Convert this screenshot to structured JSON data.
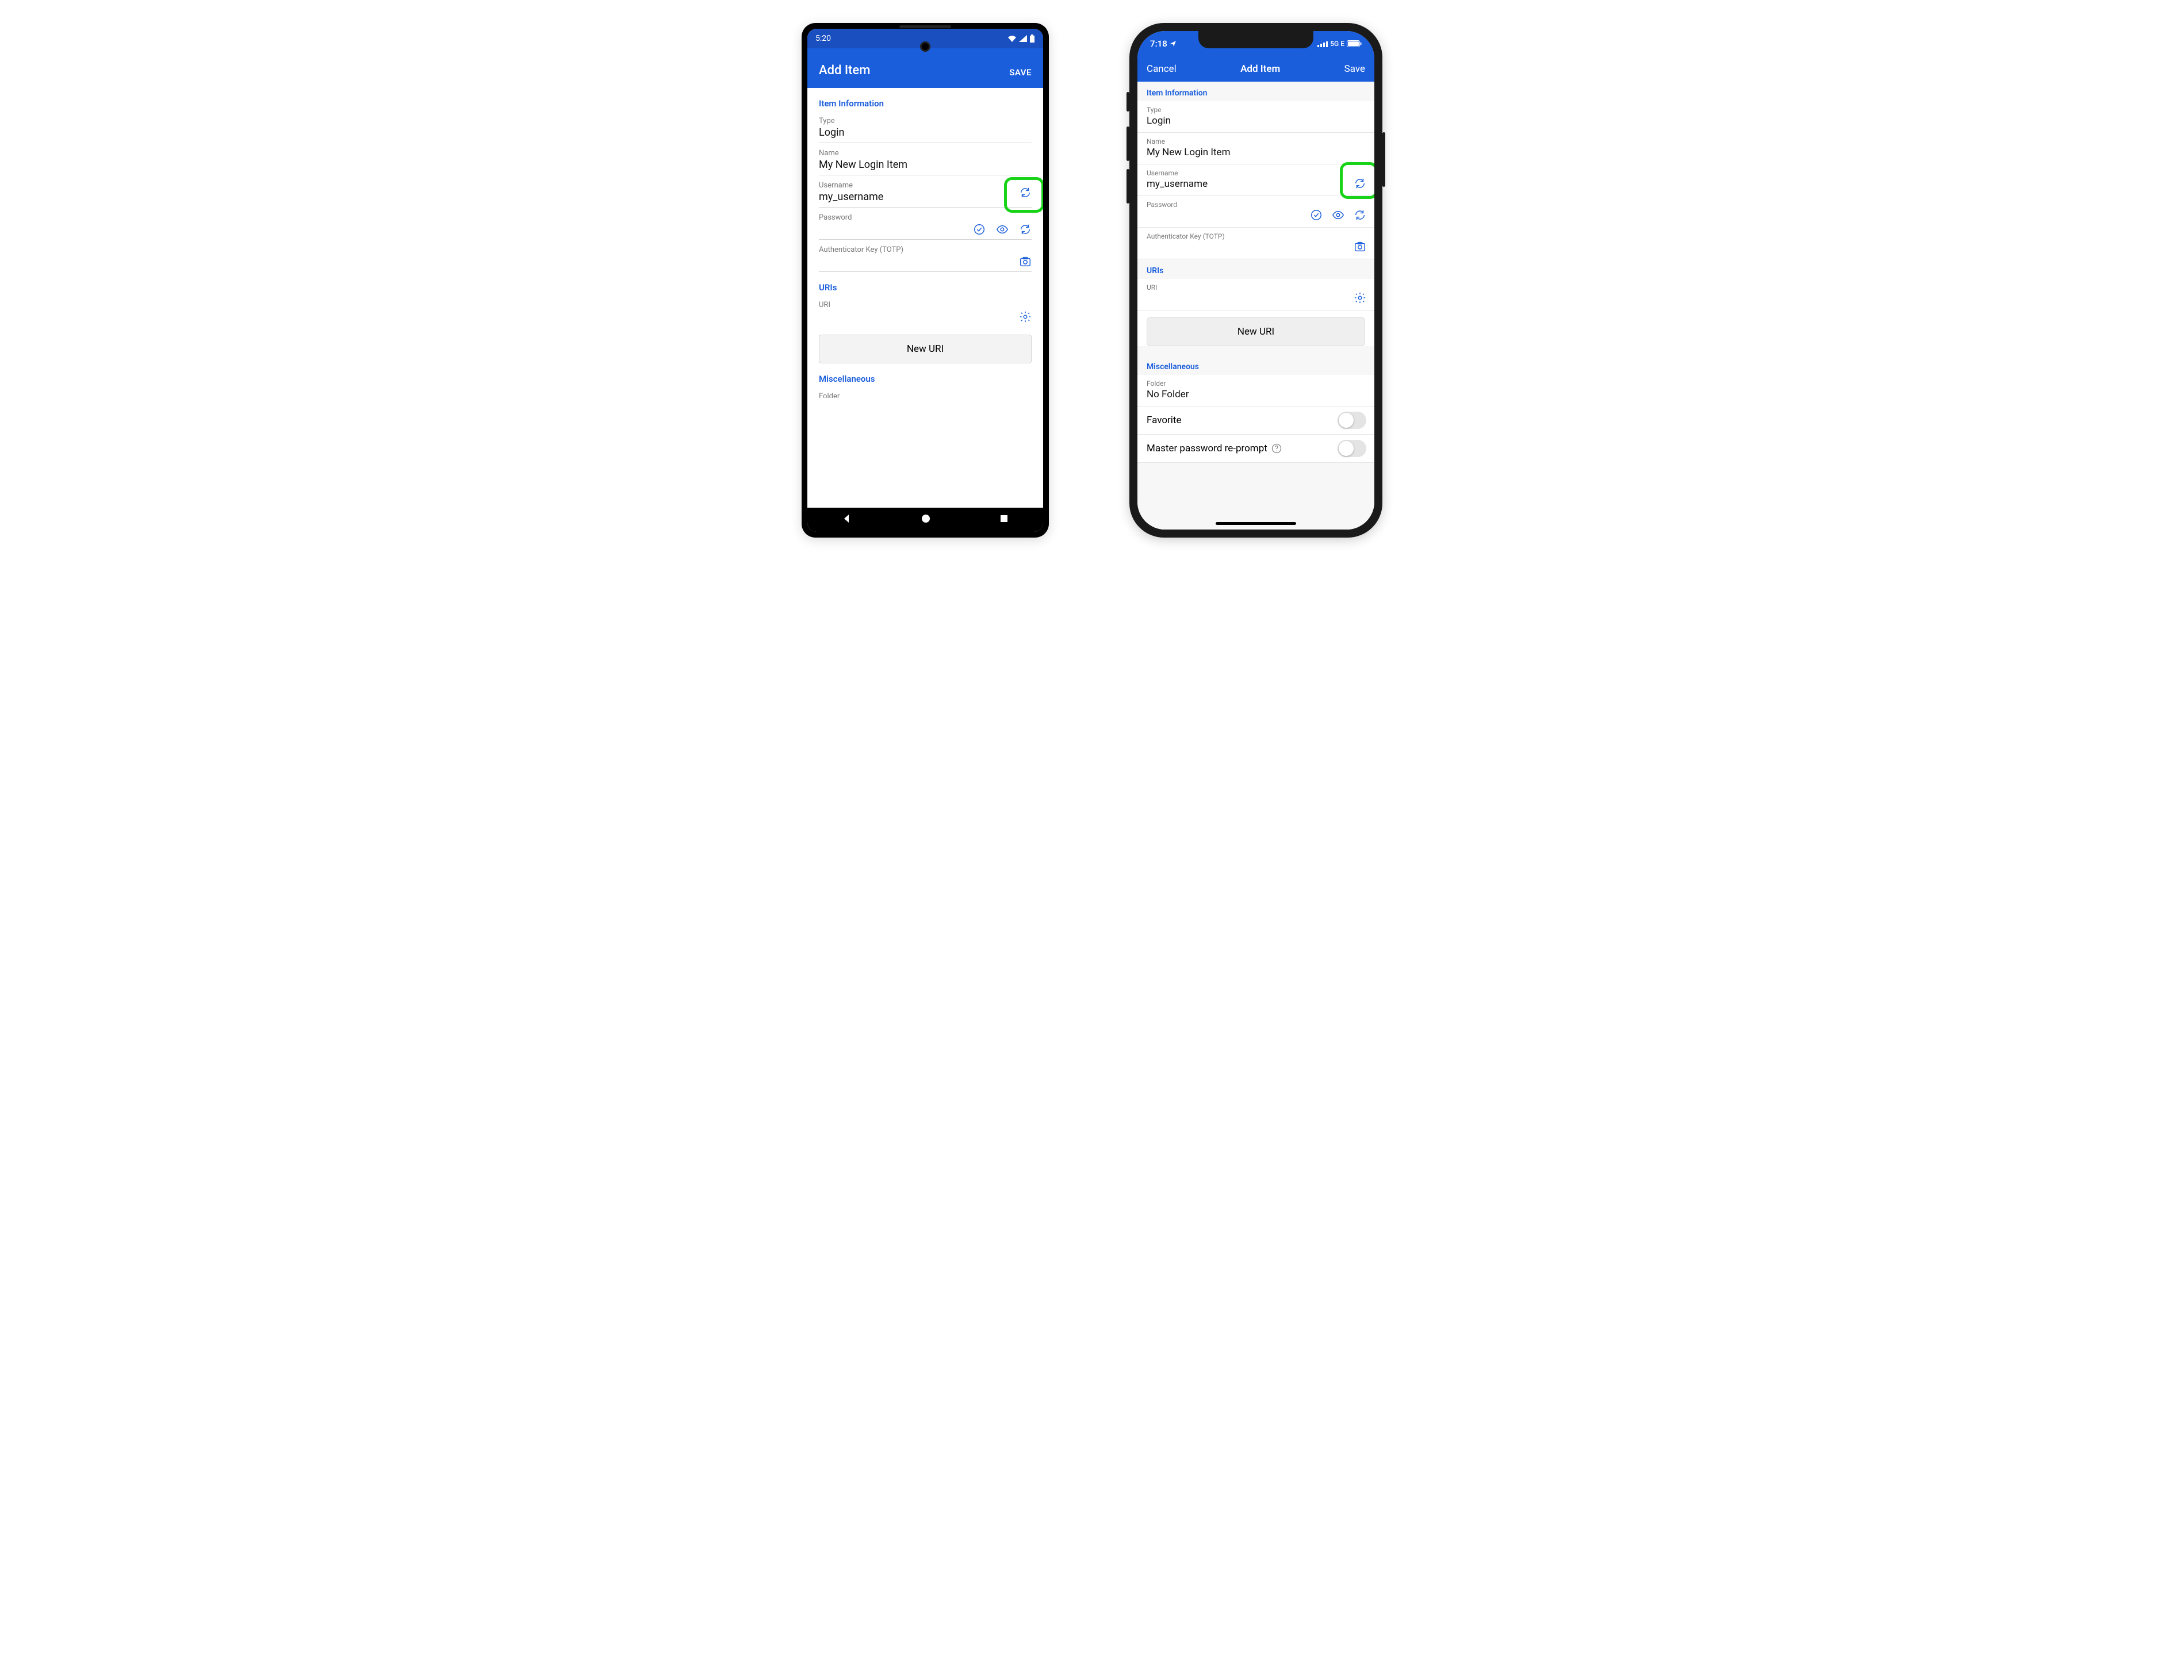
{
  "android": {
    "status": {
      "time": "5:20"
    },
    "appbar": {
      "title": "Add Item",
      "save": "SAVE"
    },
    "sections": {
      "item_info": "Item Information",
      "uris": "URIs",
      "misc": "Miscellaneous"
    },
    "fields": {
      "type": {
        "label": "Type",
        "value": "Login"
      },
      "name": {
        "label": "Name",
        "value": "My New Login Item"
      },
      "user": {
        "label": "Username",
        "value": "my_username"
      },
      "pass": {
        "label": "Password",
        "value": ""
      },
      "totp": {
        "label": "Authenticator Key (TOTP)",
        "value": ""
      },
      "uri": {
        "label": "URI",
        "value": ""
      },
      "folder": {
        "label": "Folder",
        "value": ""
      }
    },
    "buttons": {
      "new_uri": "New URI"
    }
  },
  "ios": {
    "status": {
      "time": "7:18",
      "network": "5G E"
    },
    "navbar": {
      "cancel": "Cancel",
      "title": "Add Item",
      "save": "Save"
    },
    "sections": {
      "item_info": "Item Information",
      "uris": "URIs",
      "misc": "Miscellaneous"
    },
    "fields": {
      "type": {
        "label": "Type",
        "value": "Login"
      },
      "name": {
        "label": "Name",
        "value": "My New Login Item"
      },
      "user": {
        "label": "Username",
        "value": "my_username"
      },
      "pass": {
        "label": "Password",
        "value": ""
      },
      "totp": {
        "label": "Authenticator Key (TOTP)",
        "value": ""
      },
      "uri": {
        "label": "URI",
        "value": ""
      },
      "folder": {
        "label": "Folder",
        "value": "No Folder"
      }
    },
    "rows": {
      "favorite": "Favorite",
      "reprompt": "Master password re-prompt"
    },
    "buttons": {
      "new_uri": "New URI"
    }
  }
}
